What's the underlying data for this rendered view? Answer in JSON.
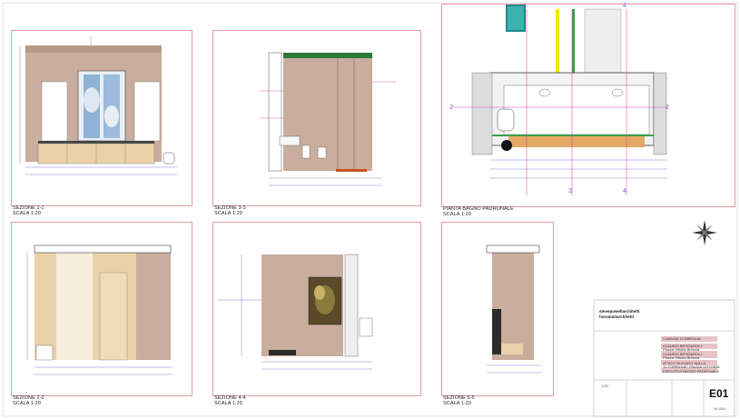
{
  "drawings": {
    "s11": "SEZIONE 1-1",
    "s33": "SEZIONE 3-3",
    "plan": "PIANTA BAGNO PADRONALE",
    "s22": "SEZIONE 2-2",
    "s44": "SEZIONE 4-4",
    "s55": "SEZIONE 5-5",
    "scale": "SCALA 1:20"
  },
  "titleblock": {
    "brand_line1": "stevepowellarchitetti",
    "brand_line2": "horamatiarchitetti",
    "location": "COMUNE DI BRESCIA",
    "client_1": "CLAUDIO BROGAROLI",
    "client_1_addr": "Piazza Vittoria Brescia",
    "client_2": "CLAUDIO BROGAROLI",
    "client_2_addr": "Piazza Vittoria Brescia",
    "project_line1": "ATTICO ELEVATO SULLA",
    "project_line2": "\"IL TORRIONE\" PIAZZA VITTORIA",
    "subject": "ESECUTIVI BAGNO PADRONALE",
    "scale_value": "1:20",
    "sheet_code": "E01",
    "sheet_sub": "06-13A1"
  },
  "palette": {
    "frame": "#e59aa6",
    "marble": "#c9ad9d",
    "wood": "#e9d2a8",
    "dim": "#6a63c9",
    "accent": "#d33aa8",
    "green": "#3aa04a"
  }
}
